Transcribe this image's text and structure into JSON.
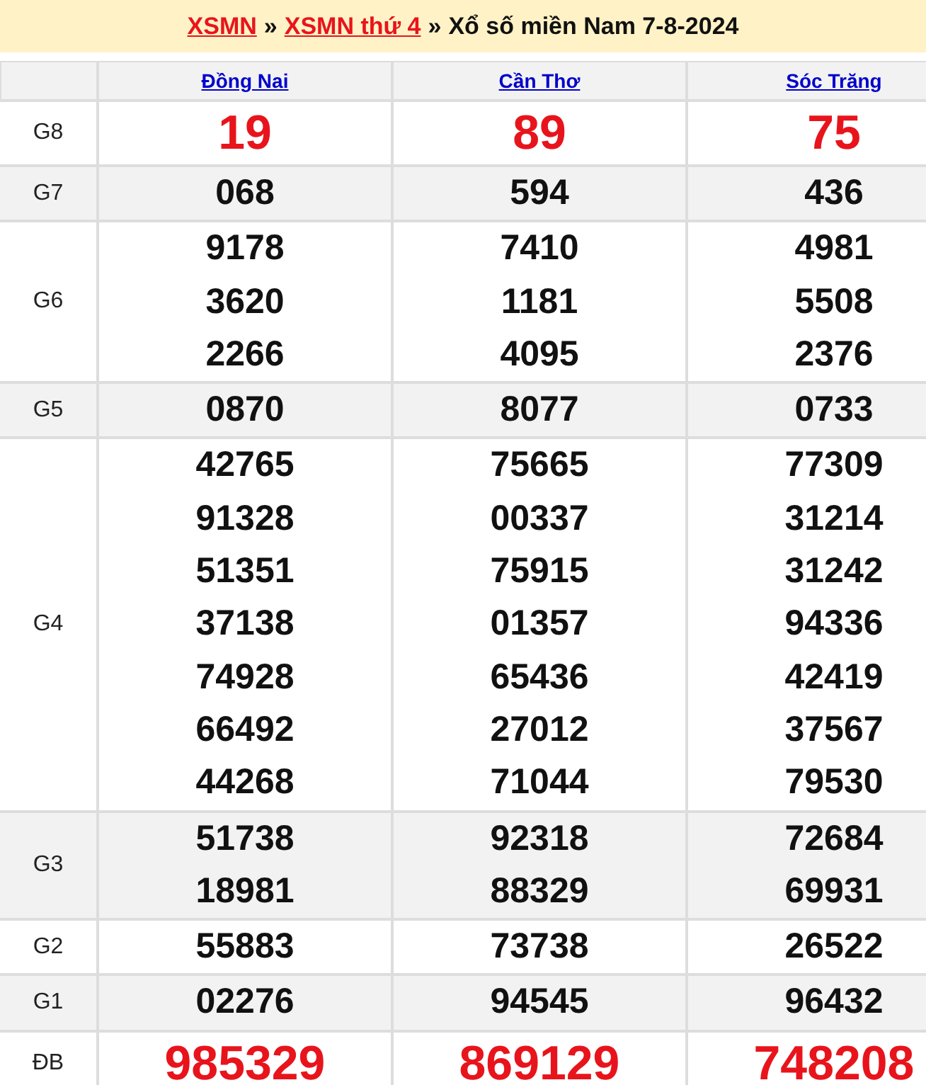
{
  "breadcrumb": [
    {
      "kind": "link",
      "text": "XSMN"
    },
    {
      "kind": "separator",
      "text": "»"
    },
    {
      "kind": "link",
      "text": "XSMN thứ 4"
    },
    {
      "kind": "separator",
      "text": "»"
    },
    {
      "kind": "current",
      "text": "Xổ số miền Nam 7-8-2024"
    }
  ],
  "provinces": [
    "Đồng Nai",
    "Cần Thơ",
    "Sóc Trăng"
  ],
  "prizes": [
    {
      "label": "G8",
      "kind": "featured",
      "results": [
        [
          "19"
        ],
        [
          "89"
        ],
        [
          "75"
        ]
      ]
    },
    {
      "label": "G7",
      "kind": "regular",
      "results": [
        [
          "068"
        ],
        [
          "594"
        ],
        [
          "436"
        ]
      ]
    },
    {
      "label": "G6",
      "kind": "regular",
      "results": [
        [
          "9178",
          "3620",
          "2266"
        ],
        [
          "7410",
          "1181",
          "4095"
        ],
        [
          "4981",
          "5508",
          "2376"
        ]
      ]
    },
    {
      "label": "G5",
      "kind": "regular",
      "results": [
        [
          "0870"
        ],
        [
          "8077"
        ],
        [
          "0733"
        ]
      ]
    },
    {
      "label": "G4",
      "kind": "regular",
      "results": [
        [
          "42765",
          "91328",
          "51351",
          "37138",
          "74928",
          "66492",
          "44268"
        ],
        [
          "75665",
          "00337",
          "75915",
          "01357",
          "65436",
          "27012",
          "71044"
        ],
        [
          "77309",
          "31214",
          "31242",
          "94336",
          "42419",
          "37567",
          "79530"
        ]
      ]
    },
    {
      "label": "G3",
      "kind": "regular",
      "results": [
        [
          "51738",
          "18981"
        ],
        [
          "92318",
          "88329"
        ],
        [
          "72684",
          "69931"
        ]
      ]
    },
    {
      "label": "G2",
      "kind": "regular",
      "results": [
        [
          "55883"
        ],
        [
          "73738"
        ],
        [
          "26522"
        ]
      ]
    },
    {
      "label": "G1",
      "kind": "regular",
      "results": [
        [
          "02276"
        ],
        [
          "94545"
        ],
        [
          "96432"
        ]
      ]
    },
    {
      "label": "ĐB",
      "kind": "featured",
      "results": [
        [
          "985329"
        ],
        [
          "869129"
        ],
        [
          "748208"
        ]
      ]
    }
  ]
}
